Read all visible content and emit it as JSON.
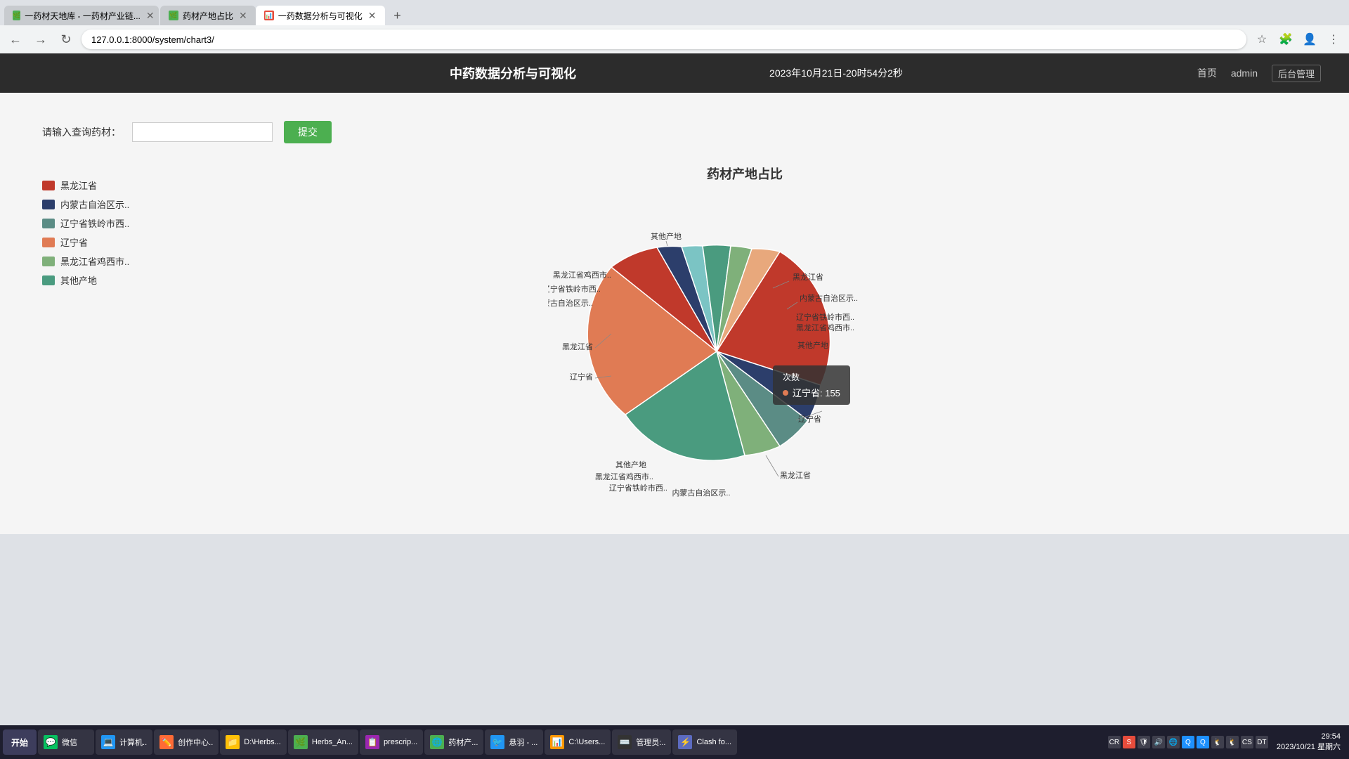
{
  "browser": {
    "tabs": [
      {
        "label": "一药材天地库 - 一药材产业链...",
        "active": false,
        "favicon": "🌿"
      },
      {
        "label": "药材产地占比",
        "active": false,
        "favicon": "🌿"
      },
      {
        "label": "一药数据分析与可视化",
        "active": true,
        "favicon": "📊"
      }
    ],
    "address": "127.0.0.1:8000/system/chart3/"
  },
  "navbar": {
    "brand": "中药数据分析与可视化",
    "time": "2023年10月21日-20时54分2秒",
    "home": "首页",
    "user": "admin",
    "admin": "后台管理"
  },
  "search": {
    "label": "请输入查询药材：",
    "placeholder": "",
    "submit": "提交"
  },
  "chart": {
    "title": "药材产地占比",
    "legend": [
      {
        "label": "黑龙江省",
        "color": "#c0392b"
      },
      {
        "label": "内蒙古自治区示..",
        "color": "#2c3e6b"
      },
      {
        "label": "辽宁省铁岭市西..",
        "color": "#5b8c85"
      },
      {
        "label": "辽宁省",
        "color": "#e07b54"
      },
      {
        "label": "黑龙江省鸡西市..",
        "color": "#7fb07a"
      },
      {
        "label": "其他产地",
        "color": "#4a9b7f"
      }
    ],
    "tooltip": {
      "title": "次数",
      "item": "辽宁省: 155",
      "dot_color": "#e07b54"
    },
    "slices": [
      {
        "label": "黑龙江省",
        "color": "#c0392b",
        "startAngle": -30,
        "endAngle": 30,
        "radius": 150,
        "labelX": 820,
        "labelY": 345
      },
      {
        "label": "内蒙古自治区示..",
        "color": "#2c3e6b",
        "startAngle": 30,
        "endAngle": 65,
        "radius": 150,
        "labelX": 830,
        "labelY": 370
      },
      {
        "label": "辽宁省铁岭市西..",
        "color": "#5b8c85",
        "startAngle": 65,
        "endAngle": 90,
        "radius": 150,
        "labelX": 820,
        "labelY": 378
      },
      {
        "label": "黑龙江省鸡西市..",
        "color": "#7fb07a",
        "startAngle": 90,
        "endAngle": 110,
        "radius": 150,
        "labelX": 880,
        "labelY": 398
      },
      {
        "label": "其他产地",
        "color": "#4a9b7f",
        "startAngle": 110,
        "endAngle": 155,
        "radius": 150,
        "labelX": 882,
        "labelY": 436
      },
      {
        "label": "辽宁省",
        "color": "#e8a87c",
        "startAngle": 155,
        "endAngle": 240,
        "radius": 150,
        "labelX": 862,
        "labelY": 552
      },
      {
        "label": "黑龙江省",
        "color": "#c0392b",
        "startAngle": 240,
        "endAngle": 270,
        "radius": 150,
        "labelX": 810,
        "labelY": 623
      },
      {
        "label": "内蒙古自治区示..",
        "color": "#2c3e6b",
        "startAngle": 270,
        "endAngle": 285,
        "radius": 150
      },
      {
        "label": "辽宁省铁岭市西..",
        "color": "#7bc4c4",
        "startAngle": 285,
        "endAngle": 300,
        "radius": 150
      },
      {
        "label": "其他产地",
        "color": "#4a9b7f",
        "startAngle": 300,
        "endAngle": 320,
        "radius": 150
      },
      {
        "label": "黑龙江省鸡西市..",
        "color": "#7fb07a",
        "startAngle": 320,
        "endAngle": 340,
        "radius": 150
      },
      {
        "label": "辽宁省",
        "color": "#e07b54",
        "startAngle": 340,
        "endAngle": 360,
        "radius": 150
      }
    ]
  },
  "taskbar": {
    "start": "开始",
    "items": [
      {
        "label": "微信",
        "color": "#07c160",
        "icon": "💬"
      },
      {
        "label": "计算机..",
        "color": "#2196F3",
        "icon": "💻"
      },
      {
        "label": "创作中心..",
        "color": "#ff6b35",
        "icon": "✏️"
      },
      {
        "label": "D:\\Herbs...",
        "color": "#ffc107",
        "icon": "📁"
      },
      {
        "label": "Herbs_An...",
        "color": "#4caf50",
        "icon": "🌿"
      },
      {
        "label": "prescrip...",
        "color": "#9c27b0",
        "icon": "📋"
      },
      {
        "label": "药材产...",
        "color": "#4caf50",
        "icon": "🌿"
      },
      {
        "label": "悬羽 - ...",
        "color": "#2196F3",
        "icon": "🐦"
      },
      {
        "label": "C:\\Users...",
        "color": "#ff9800",
        "icon": "📊"
      },
      {
        "label": "管理员:..",
        "color": "#333",
        "icon": "⌨️"
      },
      {
        "label": "Clash fo...",
        "color": "#5c6bc0",
        "icon": "⚡"
      }
    ],
    "clock_time": "29:54",
    "clock_date": "2023/10/21 星期六"
  }
}
